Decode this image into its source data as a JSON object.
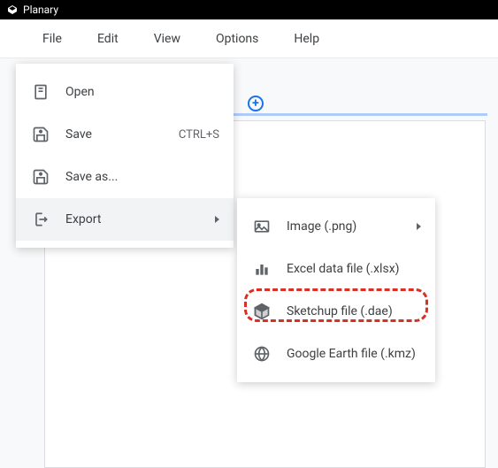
{
  "titlebar": {
    "app_name": "Planary"
  },
  "menubar": {
    "items": [
      "File",
      "Edit",
      "View",
      "Options",
      "Help"
    ]
  },
  "file_menu": {
    "items": [
      {
        "label": "Open",
        "shortcut": ""
      },
      {
        "label": "Save",
        "shortcut": "CTRL+S"
      },
      {
        "label": "Save as...",
        "shortcut": ""
      },
      {
        "label": "Export",
        "shortcut": "",
        "has_submenu": true,
        "highlighted": true
      }
    ]
  },
  "export_menu": {
    "items": [
      {
        "label": "Image (.png)",
        "has_submenu": true
      },
      {
        "label": "Excel data file (.xlsx)"
      },
      {
        "label": "Sketchup file (.dae)"
      },
      {
        "label": "Google Earth file (.kmz)"
      }
    ]
  }
}
